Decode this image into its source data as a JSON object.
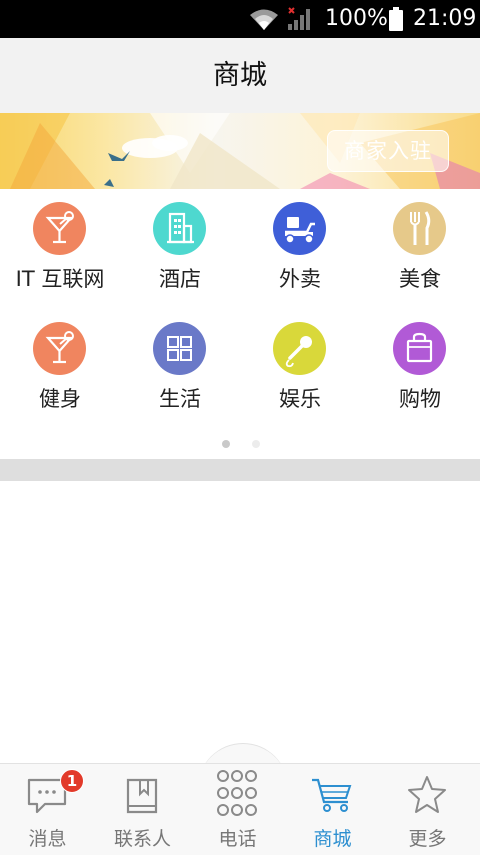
{
  "status_bar": {
    "battery": "100%",
    "time": "21:09"
  },
  "header": {
    "title": "商城"
  },
  "banner": {
    "join_label": "商家入驻"
  },
  "categories": [
    {
      "label": "IT 互联网",
      "icon": "cocktail-icon",
      "color": "#f0855f"
    },
    {
      "label": "酒店",
      "icon": "building-icon",
      "color": "#4ed8cf"
    },
    {
      "label": "外卖",
      "icon": "scooter-icon",
      "color": "#3f5fd8"
    },
    {
      "label": "美食",
      "icon": "fork-knife-icon",
      "color": "#e6c98a"
    },
    {
      "label": "健身",
      "icon": "cocktail-icon",
      "color": "#f0855f"
    },
    {
      "label": "生活",
      "icon": "grid-icon",
      "color": "#6a79c8"
    },
    {
      "label": "娱乐",
      "icon": "microphone-icon",
      "color": "#d9d83a"
    },
    {
      "label": "购物",
      "icon": "shopping-bag-icon",
      "color": "#b15ad6"
    }
  ],
  "pager": {
    "pages": 2,
    "current": 1
  },
  "tabs": [
    {
      "label": "消息",
      "icon": "chat-bubble-icon",
      "badge": "1",
      "active": false
    },
    {
      "label": "联系人",
      "icon": "contacts-book-icon",
      "active": false
    },
    {
      "label": "电话",
      "icon": "dialpad-icon",
      "active": false
    },
    {
      "label": "商城",
      "icon": "shopping-cart-icon",
      "active": true
    },
    {
      "label": "更多",
      "icon": "star-icon",
      "active": false
    }
  ],
  "colors": {
    "accent": "#2d8fd0",
    "badge": "#e23a2a",
    "tab_inactive": "#777777"
  }
}
